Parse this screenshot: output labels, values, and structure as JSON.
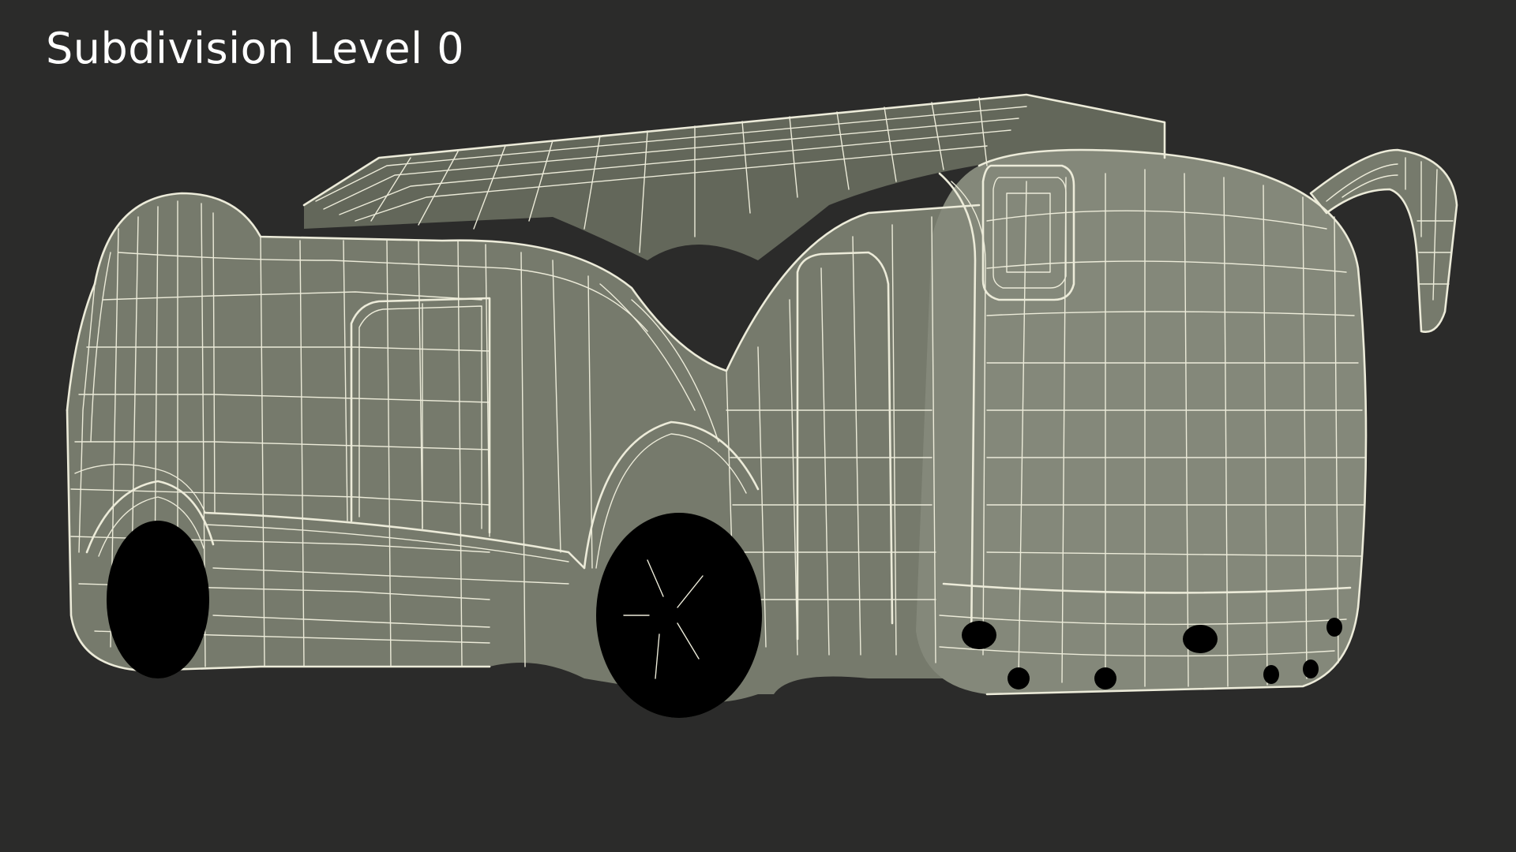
{
  "caption": {
    "text": "Subdivision Level 0"
  },
  "render": {
    "subject": "wireframe-bus-model",
    "background_color": "#2b2b2a",
    "mesh_color": "#767a6c",
    "wire_color": "#ecebd9"
  }
}
